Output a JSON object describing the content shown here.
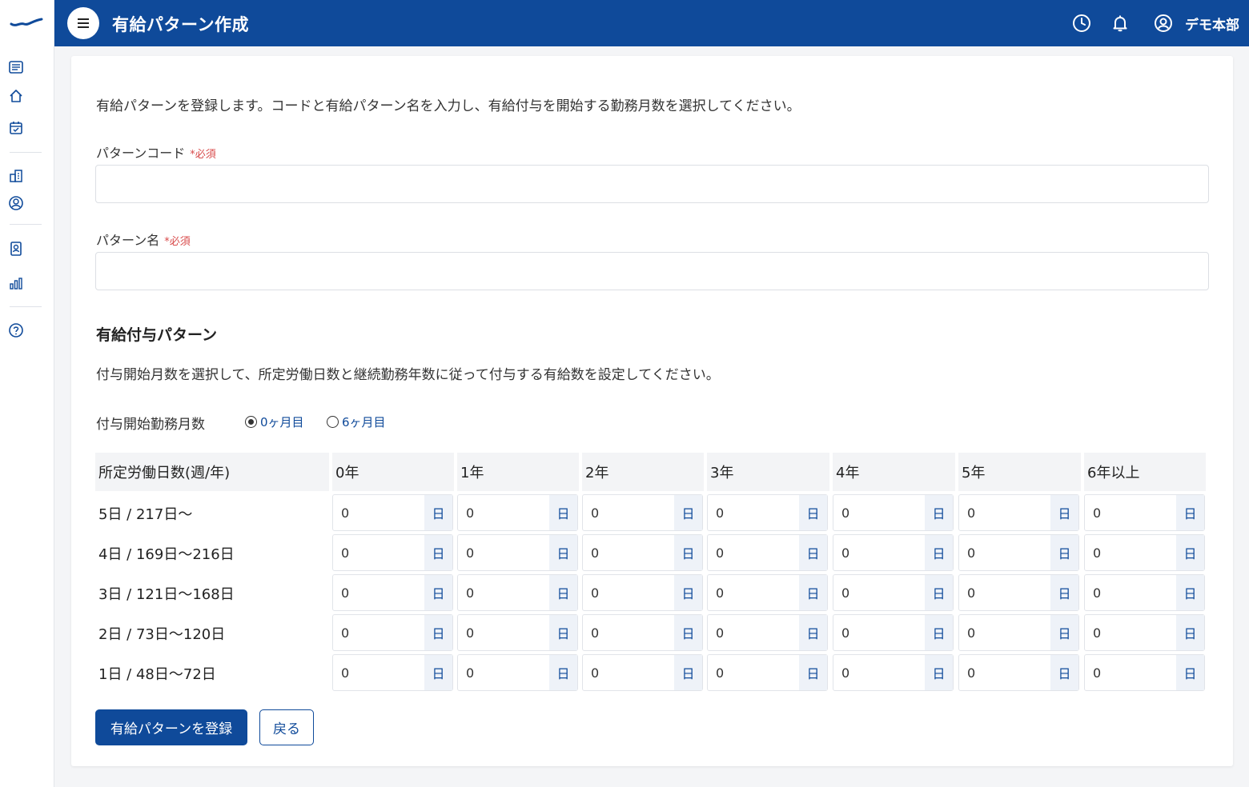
{
  "header": {
    "title": "有給パターン作成",
    "user_name": "デモ本部"
  },
  "intro": "有給パターンを登録します。コードと有給パターン名を入力し、有給付与を開始する勤務月数を選択してください。",
  "form": {
    "code_label": "パターンコード",
    "name_label": "パターン名",
    "required_mark": "*必須",
    "code_value": "",
    "name_value": ""
  },
  "grant_section": {
    "title": "有給付与パターン",
    "description": "付与開始月数を選択して、所定労働日数と継続勤務年数に従って付与する有給数を設定してください。",
    "start_label": "付与開始勤務月数",
    "options": [
      "0ヶ月目",
      "6ヶ月目"
    ],
    "selected_option": "0ヶ月目"
  },
  "grid": {
    "row_header": "所定労働日数(週/年)",
    "columns": [
      "0年",
      "1年",
      "2年",
      "3年",
      "4年",
      "5年",
      "6年以上"
    ],
    "unit": "日",
    "rows": [
      {
        "label": "5日 / 217日〜",
        "values": [
          "0",
          "0",
          "0",
          "0",
          "0",
          "0",
          "0"
        ]
      },
      {
        "label": "4日 / 169日〜216日",
        "values": [
          "0",
          "0",
          "0",
          "0",
          "0",
          "0",
          "0"
        ]
      },
      {
        "label": "3日 / 121日〜168日",
        "values": [
          "0",
          "0",
          "0",
          "0",
          "0",
          "0",
          "0"
        ]
      },
      {
        "label": "2日 / 73日〜120日",
        "values": [
          "0",
          "0",
          "0",
          "0",
          "0",
          "0",
          "0"
        ]
      },
      {
        "label": "1日 / 48日〜72日",
        "values": [
          "0",
          "0",
          "0",
          "0",
          "0",
          "0",
          "0"
        ]
      }
    ]
  },
  "buttons": {
    "submit": "有給パターンを登録",
    "back": "戻る"
  },
  "colors": {
    "primary": "#0f4a9a",
    "required": "#d84a4a"
  }
}
